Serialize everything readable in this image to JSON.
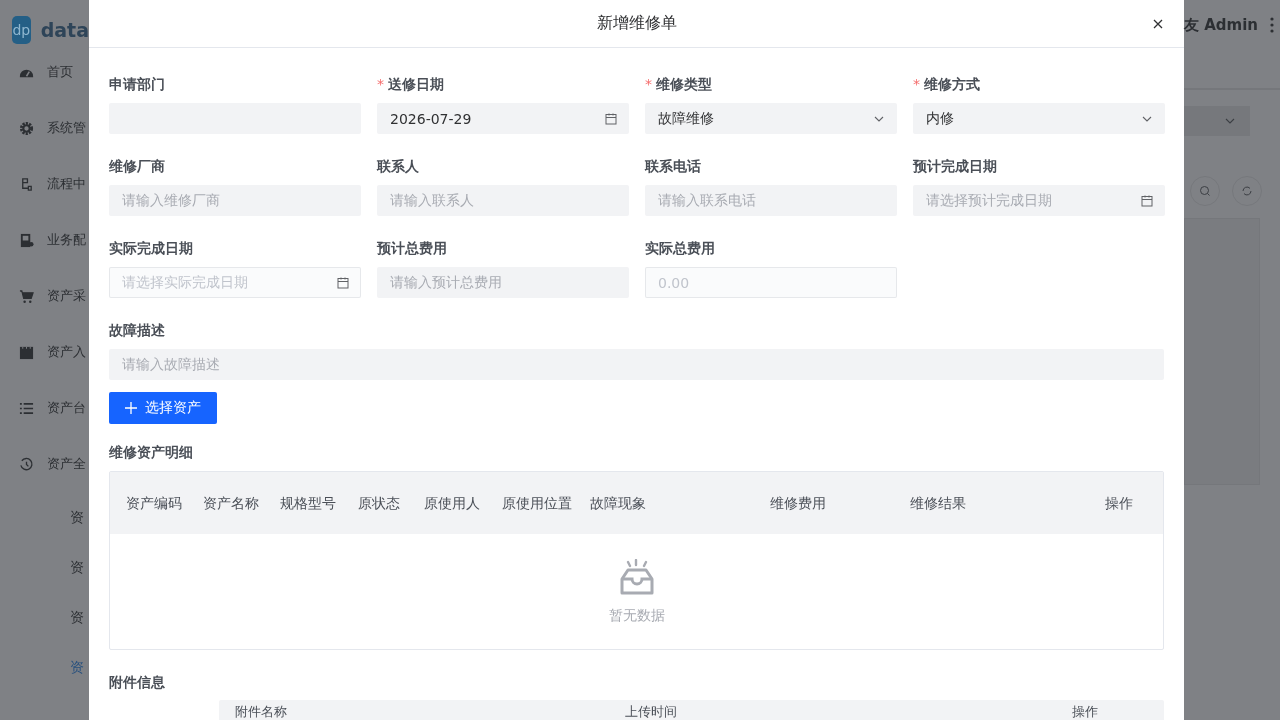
{
  "sidebar": {
    "logo": "dp",
    "brand": "data",
    "items": [
      {
        "label": "首页"
      },
      {
        "label": "系统管"
      },
      {
        "label": "流程中"
      },
      {
        "label": "业务配"
      },
      {
        "label": "资产采"
      },
      {
        "label": "资产入"
      },
      {
        "label": "资产台"
      },
      {
        "label": "资产全"
      }
    ],
    "sub_items": [
      {
        "label": "资",
        "selected": false
      },
      {
        "label": "资",
        "selected": false
      },
      {
        "label": "资",
        "selected": false
      },
      {
        "label": "资",
        "selected": true
      }
    ]
  },
  "header": {
    "user": "友 Admin"
  },
  "dialog": {
    "title": "新增维修单",
    "required_mark": "*",
    "fields": [
      {
        "label": "申请部门",
        "required": false,
        "kind": "text",
        "disabled": false
      },
      {
        "label": "送修日期",
        "required": true,
        "kind": "date",
        "value": "2026-07-29",
        "disabled": false
      },
      {
        "label": "维修类型",
        "required": true,
        "kind": "select",
        "value": "故障维修",
        "disabled": false
      },
      {
        "label": "维修方式",
        "required": true,
        "kind": "select",
        "value": "内修",
        "disabled": false
      },
      {
        "label": "维修厂商",
        "required": false,
        "kind": "text",
        "placeholder": "请输入维修厂商",
        "disabled": false
      },
      {
        "label": "联系人",
        "required": false,
        "kind": "text",
        "placeholder": "请输入联系人",
        "disabled": false
      },
      {
        "label": "联系电话",
        "required": false,
        "kind": "text",
        "placeholder": "请输入联系电话",
        "disabled": false
      },
      {
        "label": "预计完成日期",
        "required": false,
        "kind": "date",
        "placeholder": "请选择预计完成日期",
        "disabled": false
      },
      {
        "label": "实际完成日期",
        "required": false,
        "kind": "date",
        "placeholder": "请选择实际完成日期",
        "disabled": true
      },
      {
        "label": "预计总费用",
        "required": false,
        "kind": "text",
        "placeholder": "请输入预计总费用",
        "disabled": false
      },
      {
        "label": "实际总费用",
        "required": false,
        "kind": "text",
        "placeholder": "0.00",
        "disabled": true
      }
    ],
    "description": {
      "label": "故障描述",
      "placeholder": "请输入故障描述"
    },
    "select_button": "选择资产",
    "detail_title": "维修资产明细",
    "detail_columns": [
      "资产编码",
      "资产名称",
      "规格型号",
      "原状态",
      "原使用人",
      "原使用位置",
      "故障现象",
      "维修费用",
      "维修结果",
      "操作"
    ],
    "empty_text": "暂无数据",
    "attachments_title": "附件信息",
    "attachment_columns": [
      "附件名称",
      "上传时间",
      "操作"
    ]
  }
}
